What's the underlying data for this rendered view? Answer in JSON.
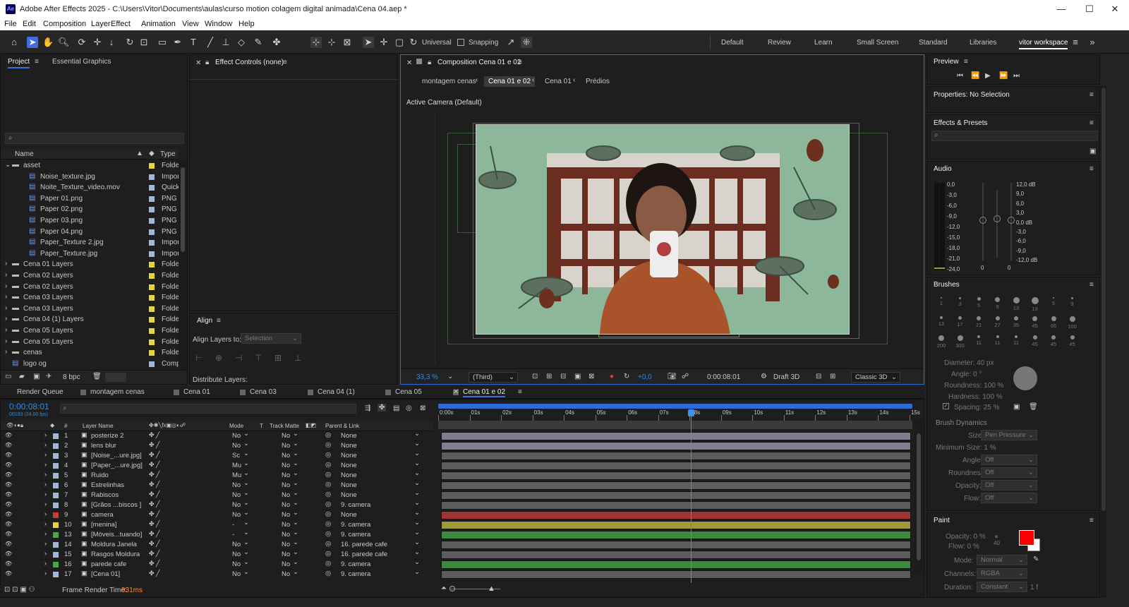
{
  "window": {
    "title": "Adobe After Effects 2025 - C:\\Users\\Vitor\\Documents\\aulas\\curso motion colagem digital animada\\Cena 04.aep *",
    "app_icon": "Ae",
    "min": "—",
    "max": "☐",
    "close": "✕"
  },
  "menu": [
    "File",
    "Edit",
    "Composition",
    "Layer",
    "Effect",
    "Animation",
    "View",
    "Window",
    "Help"
  ],
  "toolbar": {
    "universal": "Universal",
    "snapping": "Snapping"
  },
  "workspaces": [
    "Default",
    "Review",
    "Learn",
    "Small Screen",
    "Standard",
    "Libraries",
    "vitor workspace"
  ],
  "project": {
    "tab": "Project",
    "tab2": "Essential Graphics",
    "col_name": "Name",
    "col_type": "Type",
    "bpc": "8 bpc",
    "items": [
      {
        "name": "asset",
        "type": "Folder",
        "color": "#e8d33c",
        "indent": 0,
        "folder": true,
        "open": true
      },
      {
        "name": "Noise_texture.jpg",
        "type": "Impor",
        "color": "#a4b6d8",
        "indent": 1
      },
      {
        "name": "Noite_Texture_video.mov",
        "type": "Quick",
        "color": "#a4b6d8",
        "indent": 1
      },
      {
        "name": "Paper 01.png",
        "type": "PNG f",
        "color": "#a4b6d8",
        "indent": 1
      },
      {
        "name": "Paper 02.png",
        "type": "PNG f",
        "color": "#a4b6d8",
        "indent": 1
      },
      {
        "name": "Paper 03.png",
        "type": "PNG f",
        "color": "#a4b6d8",
        "indent": 1
      },
      {
        "name": "Paper 04.png",
        "type": "PNG f",
        "color": "#a4b6d8",
        "indent": 1
      },
      {
        "name": "Paper_Texture 2.jpg",
        "type": "Impor",
        "color": "#a4b6d8",
        "indent": 1
      },
      {
        "name": "Paper_Texture.jpg",
        "type": "Impor",
        "color": "#a4b6d8",
        "indent": 1
      },
      {
        "name": "Cena 01 Layers",
        "type": "Folder",
        "color": "#e8d33c",
        "indent": 0,
        "folder": true
      },
      {
        "name": "Cena 02 Layers",
        "type": "Folder",
        "color": "#e8d33c",
        "indent": 0,
        "folder": true
      },
      {
        "name": "Cena 02 Layers",
        "type": "Folder",
        "color": "#e8d33c",
        "indent": 0,
        "folder": true
      },
      {
        "name": "Cena 03 Layers",
        "type": "Folder",
        "color": "#e8d33c",
        "indent": 0,
        "folder": true
      },
      {
        "name": "Cena 03 Layers",
        "type": "Folder",
        "color": "#e8d33c",
        "indent": 0,
        "folder": true
      },
      {
        "name": "Cena 04 (1) Layers",
        "type": "Folder",
        "color": "#e8d33c",
        "indent": 0,
        "folder": true
      },
      {
        "name": "Cena 05 Layers",
        "type": "Folder",
        "color": "#e8d33c",
        "indent": 0,
        "folder": true
      },
      {
        "name": "Cena 05 Layers",
        "type": "Folder",
        "color": "#e8d33c",
        "indent": 0,
        "folder": true
      },
      {
        "name": "cenas",
        "type": "Folder",
        "color": "#e8d33c",
        "indent": 0,
        "folder": true
      },
      {
        "name": "logo og",
        "type": "Comp",
        "color": "#a4b6d8",
        "indent": 0
      }
    ]
  },
  "effect_controls": {
    "tab": "Effect Controls (none)"
  },
  "align": {
    "tab": "Align",
    "label": "Align Layers to:",
    "value": "Selection",
    "distribute": "Distribute Layers:"
  },
  "composition": {
    "tab": "Composition Cena 01 e 02",
    "crumbs": [
      "montagem cenas",
      "Cena 01 e 02",
      "Cena 01",
      "Prédios"
    ],
    "camera": "Active Camera (Default)",
    "zoom": "33,3",
    "zoom_unit": "%",
    "view": "(Third)",
    "exposure": "+0,0",
    "timecode": "0:00:08:01",
    "renderer": "Draft 3D",
    "mode": "Classic 3D"
  },
  "preview": {
    "tab": "Preview"
  },
  "properties": {
    "tab": "Properties: No Selection"
  },
  "effects": {
    "tab": "Effects & Presets"
  },
  "audio": {
    "tab": "Audio",
    "left": [
      "0,0",
      "-3,0",
      "-6,0",
      "-9,0",
      "-12,0",
      "-15,0",
      "-18,0",
      "-21,0",
      "-24,0"
    ],
    "right": [
      "12,0 dB",
      "9,0",
      "6,0",
      "3,0",
      "0,0 dB",
      "-3,0",
      "-6,0",
      "-9,0",
      "-12,0 dB"
    ],
    "zero_a": "0",
    "zero_b": "0"
  },
  "brushes": {
    "tab": "Brushes",
    "sizes": [
      "1",
      "3",
      "5",
      "9",
      "13",
      "19",
      "5",
      "9",
      "13",
      "17",
      "21",
      "27",
      "35",
      "45",
      "65",
      "100",
      "200",
      "300",
      "11",
      "11",
      "11",
      "45",
      "45",
      "45"
    ],
    "diameter": "Diameter: 40 px",
    "angle": "Angle: 0 °",
    "roundness": "Roundness: 100 %",
    "hardness": "Hardness: 100 %",
    "spacing": "Spacing: 25 %",
    "dynamics": "Brush Dynamics",
    "size_label": "Size:",
    "size_val": "Pen Pressure",
    "min_size": "Minimum Size: 1 %",
    "angle_label": "Angle:",
    "angle_val": "Off",
    "round_label": "Roundness:",
    "round_val": "Off",
    "opacity_label": "Opacity:",
    "opacity_val": "Off",
    "flow_label": "Flow:",
    "flow_val": "Off"
  },
  "paint": {
    "tab": "Paint",
    "opacity": "Opacity: 0 %",
    "flow": "Flow: 0 %",
    "num": "40",
    "mode_label": "Mode:",
    "mode_val": "Normal",
    "channels_label": "Channels:",
    "channels_val": "RGBA",
    "duration_label": "Duration:",
    "duration_val": "Constant",
    "duration_suffix": "1 f",
    "fg": "#ff0000",
    "bg": "#ffffff"
  },
  "tabs_bottom": [
    "Render Queue",
    "montagem cenas",
    "Cena 01",
    "Cena 03",
    "Cena 04 (1)",
    "Cena 05",
    "Cena 01 e 02"
  ],
  "timeline": {
    "timecode": "0:00:08:01",
    "fps": "00193 (24.00 fps)",
    "cols": {
      "num": "#",
      "name": "Layer Name",
      "mode": "Mode",
      "t": "T",
      "matte": "Track Matte",
      "parent": "Parent & Link"
    },
    "ruler": [
      "0:00s",
      "01s",
      "02s",
      "03s",
      "04s",
      "05s",
      "06s",
      "07s",
      "08s",
      "09s",
      "10s",
      "11s",
      "12s",
      "13s",
      "14s",
      "15s"
    ],
    "playhead_s": 8.04,
    "duration_s": 15,
    "layers": [
      {
        "n": "1",
        "name": "posterize 2",
        "mode": "No",
        "matte": "No",
        "parent": "None",
        "color": "#a4b6d8",
        "bar": "#7e7e8e"
      },
      {
        "n": "2",
        "name": "lens blur",
        "mode": "No",
        "matte": "No",
        "parent": "None",
        "color": "#a4b6d8",
        "bar": "#7e7e8e"
      },
      {
        "n": "3",
        "name": "[Noise_...ure.jpg]",
        "mode": "Sc",
        "matte": "No",
        "parent": "None",
        "color": "#a4b6d8",
        "bar": "#5c5c5c"
      },
      {
        "n": "4",
        "name": "[Paper_...ure.jpg]",
        "mode": "Mu",
        "matte": "No",
        "parent": "None",
        "color": "#a4b6d8",
        "bar": "#5c5c5c"
      },
      {
        "n": "5",
        "name": "Ruido",
        "mode": "Mu",
        "matte": "No",
        "parent": "None",
        "color": "#a4b6d8",
        "bar": "#5c5c5c"
      },
      {
        "n": "6",
        "name": "Estrelinhas",
        "mode": "No",
        "matte": "No",
        "parent": "None",
        "color": "#a4b6d8",
        "bar": "#5c5c5c"
      },
      {
        "n": "7",
        "name": "Rabiscos",
        "mode": "No",
        "matte": "No",
        "parent": "None",
        "color": "#a4b6d8",
        "bar": "#5c5c5c"
      },
      {
        "n": "8",
        "name": "[Grãos ...biscos ]",
        "mode": "No",
        "matte": "No",
        "parent": "9. camera",
        "color": "#a4b6d8",
        "bar": "#5c5c5c"
      },
      {
        "n": "9",
        "name": "camera",
        "mode": "No",
        "matte": "No",
        "parent": "None",
        "color": "#c83c3c",
        "bar": "#a03434"
      },
      {
        "n": "10",
        "name": "[menina]",
        "mode": "-",
        "matte": "No",
        "parent": "9. camera",
        "color": "#e8d33c",
        "bar": "#a09a3a"
      },
      {
        "n": "13",
        "name": "[Móveis...tuando]",
        "mode": "-",
        "matte": "No",
        "parent": "9. camera",
        "color": "#4da64d",
        "bar": "#3d8a3d"
      },
      {
        "n": "14",
        "name": "Moldura Janela",
        "mode": "No",
        "matte": "No",
        "parent": "16. parede cafe",
        "color": "#a4b6d8",
        "bar": "#5c5c5c"
      },
      {
        "n": "15",
        "name": "Rasgos Moldura",
        "mode": "No",
        "matte": "No",
        "parent": "16. parede cafe",
        "color": "#a4b6d8",
        "bar": "#5c5c5c"
      },
      {
        "n": "16",
        "name": "parede cafe",
        "mode": "No",
        "matte": "No",
        "parent": "9. camera",
        "color": "#4da64d",
        "bar": "#3d8a3d"
      },
      {
        "n": "17",
        "name": "[Cena 01]",
        "mode": "No",
        "matte": "No",
        "parent": "9. camera",
        "color": "#a4b6d8",
        "bar": "#5c5c5c"
      }
    ]
  },
  "status": {
    "label": "Frame Render Time:",
    "value": "931ms"
  }
}
